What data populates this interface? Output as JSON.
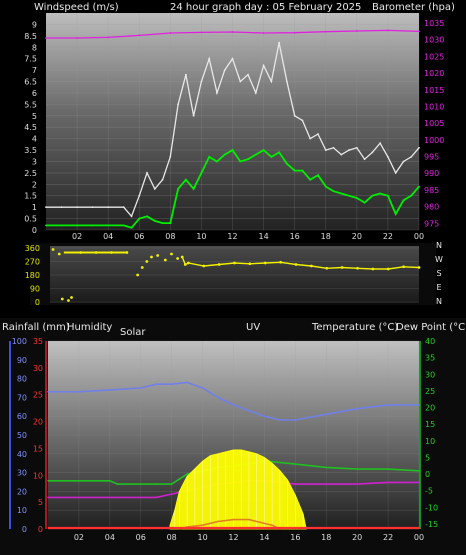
{
  "chart_data": [
    {
      "type": "line",
      "title": "24 hour graph day : 05 February 2025",
      "left_label": "Windspeed (m/s)",
      "right_label": "Barometer (hpa)",
      "x_ticks": [
        "02",
        "04",
        "06",
        "08",
        "10",
        "12",
        "14",
        "16",
        "18",
        "20",
        "22",
        "00"
      ],
      "y_left_ticks": [
        "0",
        "0.5",
        "1",
        "1.5",
        "2",
        "2.5",
        "3",
        "3.5",
        "4",
        "4.5",
        "5",
        "5.5",
        "6",
        "6.5",
        "7",
        "7.5",
        "8",
        "8.5",
        "9"
      ],
      "y_left_range": [
        0,
        9.5
      ],
      "y_right_ticks": [
        "975",
        "980",
        "985",
        "990",
        "995",
        "1000",
        "1005",
        "1010",
        "1015",
        "1020",
        "1025",
        "1030",
        "1035"
      ],
      "y_right_range": [
        973,
        1038
      ],
      "colors": {
        "gust": "#e8e8e8",
        "speed": "#00ee00",
        "pressure": "#e020e0"
      },
      "series": [
        {
          "key": "gust",
          "x": [
            0,
            1,
            2,
            3,
            4,
            5,
            5.5,
            6,
            6.5,
            7,
            7.5,
            8,
            8.5,
            9,
            9.5,
            10,
            10.5,
            11,
            11.5,
            12,
            12.5,
            13,
            13.5,
            14,
            14.5,
            15,
            15.5,
            16,
            16.5,
            17,
            17.5,
            18,
            18.5,
            19,
            19.5,
            20,
            20.5,
            21,
            21.5,
            22,
            22.5,
            23,
            23.5,
            24
          ],
          "y": [
            1,
            1,
            1,
            1,
            1,
            1,
            0.6,
            1.5,
            2.5,
            1.8,
            2.2,
            3.2,
            5.5,
            6.8,
            5,
            6.5,
            7.5,
            6,
            7,
            7.5,
            6.5,
            6.8,
            6,
            7.2,
            6.5,
            8.2,
            6.5,
            5,
            4.8,
            4,
            4.2,
            3.5,
            3.6,
            3.3,
            3.5,
            3.6,
            3.1,
            3.4,
            3.8,
            3.2,
            2.5,
            3,
            3.2,
            3.6
          ]
        },
        {
          "key": "speed",
          "x": [
            0,
            1,
            2,
            3,
            4,
            5,
            5.5,
            6,
            6.5,
            7,
            7.5,
            8,
            8.5,
            9,
            9.5,
            10,
            10.5,
            11,
            11.5,
            12,
            12.5,
            13,
            13.5,
            14,
            14.5,
            15,
            15.5,
            16,
            16.5,
            17,
            17.5,
            18,
            18.5,
            19,
            19.5,
            20,
            20.5,
            21,
            21.5,
            22,
            22.5,
            23,
            23.5,
            24
          ],
          "y": [
            0.2,
            0.2,
            0.2,
            0.2,
            0.2,
            0.2,
            0.1,
            0.5,
            0.6,
            0.4,
            0.3,
            0.3,
            1.8,
            2.2,
            1.8,
            2.5,
            3.2,
            3,
            3.3,
            3.5,
            3,
            3.1,
            3.3,
            3.5,
            3.2,
            3.4,
            2.9,
            2.6,
            2.6,
            2.2,
            2.4,
            1.9,
            1.7,
            1.6,
            1.5,
            1.4,
            1.2,
            1.5,
            1.6,
            1.5,
            0.7,
            1.3,
            1.5,
            1.9
          ]
        },
        {
          "key": "pressure",
          "x": [
            0,
            2,
            4,
            6,
            8,
            10,
            12,
            14,
            16,
            18,
            20,
            22,
            24
          ],
          "y": [
            1030.5,
            1030.5,
            1030.7,
            1031.3,
            1032,
            1032.2,
            1032.3,
            1032,
            1032.1,
            1032.4,
            1032.6,
            1032.8,
            1032.5
          ]
        }
      ]
    },
    {
      "type": "scatter",
      "title": "",
      "x_ticks": [
        "02",
        "04",
        "06",
        "08",
        "10",
        "12",
        "14",
        "16",
        "18",
        "20",
        "22",
        "00"
      ],
      "y_ticks": [
        "0",
        "90",
        "180",
        "270",
        "360"
      ],
      "y_range": [
        0,
        360
      ],
      "compass": [
        "N",
        "W",
        "S",
        "E",
        "N"
      ],
      "colors": {
        "direction": "#f0f000"
      },
      "series": [
        {
          "key": "direction",
          "x": [
            0.2,
            0.6,
            0.8,
            1.2,
            1.4,
            2,
            3,
            4,
            5,
            5.7,
            6,
            6.3,
            6.6,
            7,
            7.5,
            7.9,
            8.3,
            8.6,
            8.8,
            9,
            10,
            11,
            12,
            13,
            14,
            15,
            16,
            17,
            18,
            19,
            20,
            21,
            22,
            23,
            24
          ],
          "y": [
            350,
            320,
            20,
            10,
            30,
            330,
            330,
            330,
            330,
            180,
            230,
            270,
            300,
            310,
            280,
            320,
            290,
            300,
            250,
            260,
            240,
            250,
            260,
            255,
            260,
            265,
            250,
            240,
            225,
            230,
            225,
            220,
            220,
            235,
            230
          ]
        }
      ]
    },
    {
      "type": "line",
      "title": "",
      "labels": [
        "Rainfall (mm)",
        "Humidity",
        "Solar",
        "UV",
        "Temperature (°C)",
        "Dew Point (°C)"
      ],
      "x_ticks": [
        "02",
        "04",
        "06",
        "08",
        "10",
        "12",
        "14",
        "16",
        "18",
        "20",
        "22",
        "00"
      ],
      "humidity_ticks": [
        "0",
        "10",
        "20",
        "30",
        "40",
        "50",
        "60",
        "70",
        "80",
        "90",
        "100"
      ],
      "humidity_range": [
        0,
        100
      ],
      "rain_ticks": [
        "0",
        "5",
        "10",
        "15",
        "20",
        "25",
        "30",
        "35"
      ],
      "rain_range": [
        0,
        35
      ],
      "temp_ticks": [
        "-15",
        "-10",
        "-5",
        "0",
        "5",
        "10",
        "15",
        "20",
        "25",
        "30",
        "35",
        "40"
      ],
      "temp_range": [
        -16.5,
        40
      ],
      "colors": {
        "humidity": "#7080e8",
        "temperature": "#20c020",
        "dewpoint": "#d020d0",
        "solar": "#ffff00",
        "uv": "#e08020",
        "rain": "#ff3030"
      },
      "series": [
        {
          "key": "humidity",
          "x": [
            0,
            2,
            4,
            6,
            7,
            8,
            9,
            10,
            11,
            12,
            13,
            14,
            15,
            16,
            18,
            20,
            22,
            24
          ],
          "y": [
            73,
            73,
            74,
            75,
            77,
            77,
            78,
            75,
            70,
            66,
            63,
            60,
            58,
            58,
            61,
            64,
            66,
            66
          ]
        },
        {
          "key": "temperature",
          "x": [
            0,
            2,
            4,
            4.5,
            5,
            6,
            7,
            8,
            8.5,
            9,
            10,
            11,
            12,
            13,
            14,
            15,
            16,
            18,
            20,
            22,
            24
          ],
          "y": [
            -2,
            -2,
            -2,
            -3,
            -3,
            -3,
            -3,
            -3,
            -1.5,
            0,
            1,
            2,
            2.5,
            3,
            4,
            3.5,
            3,
            2,
            1.5,
            1.5,
            1
          ]
        },
        {
          "key": "dewpoint",
          "x": [
            0,
            2,
            4,
            5,
            6,
            7,
            8,
            9,
            10,
            11,
            12,
            13,
            14,
            15,
            16,
            18,
            20,
            22,
            24
          ],
          "y": [
            -7,
            -7,
            -7,
            -7,
            -7,
            -7,
            -6,
            -5,
            -4,
            -3,
            -2.5,
            -2,
            -2,
            -2.5,
            -3,
            -3,
            -3,
            -2.5,
            -2.5
          ]
        },
        {
          "key": "solar",
          "x": [
            7.9,
            8.2,
            8.5,
            9,
            9.5,
            10,
            10.5,
            11,
            11.5,
            12,
            12.5,
            13,
            13.5,
            14,
            14.5,
            15,
            15.5,
            16,
            16.5,
            16.7
          ],
          "y": [
            2,
            10,
            20,
            28,
            32,
            36,
            39,
            40,
            41,
            42,
            42,
            41,
            40,
            38,
            35,
            31,
            26,
            18,
            8,
            0
          ]
        },
        {
          "key": "uv",
          "x": [
            8.5,
            9,
            10,
            11,
            12,
            13,
            14,
            14.5,
            15
          ],
          "y": [
            0,
            1,
            2,
            4,
            5,
            5,
            3,
            2,
            0
          ]
        },
        {
          "key": "rain",
          "x": [
            0,
            24
          ],
          "y": [
            0,
            0
          ]
        }
      ]
    }
  ]
}
